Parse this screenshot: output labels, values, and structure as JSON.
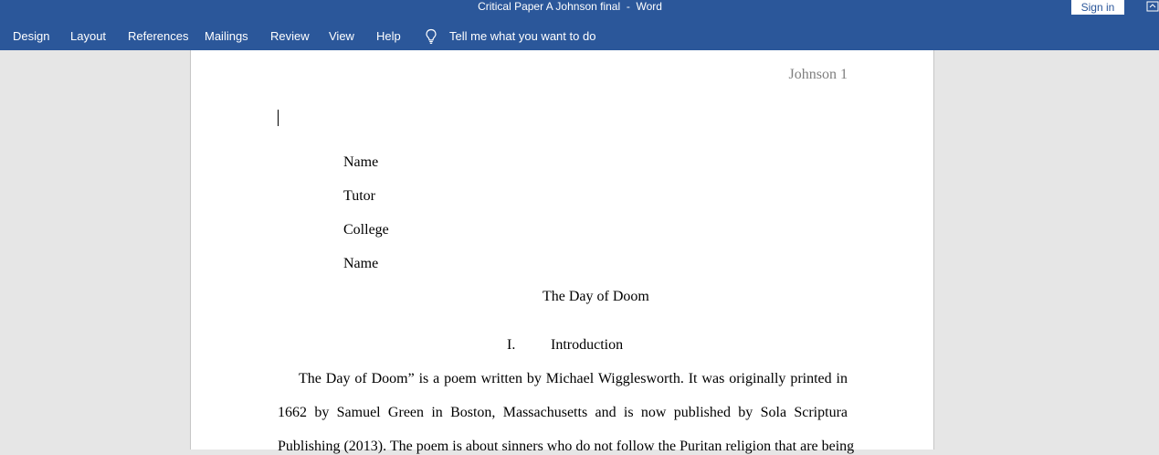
{
  "window": {
    "title": "Critical Paper A Johnson final  -  Word",
    "sign_in": "Sign in"
  },
  "ribbon": {
    "tabs": [
      "Design",
      "Layout",
      "References",
      "Mailings",
      "Review",
      "View",
      "Help"
    ],
    "tell_me": "Tell me what you want to do"
  },
  "document": {
    "header": "Johnson 1",
    "heading_lines": [
      "Name",
      "Tutor",
      "College",
      "Name"
    ],
    "title": "The Day of Doom",
    "section_number": "I.",
    "section_title": "Introduction",
    "body_lines": [
      "The Day of Doom” is a poem written by Michael Wigglesworth. It was originally printed in",
      "1662 by Samuel Green in Boston, Massachusetts and is now published by Sola Scriptura",
      "Publishing (2013). The poem is about sinners who do not follow the Puritan religion that are being"
    ]
  }
}
